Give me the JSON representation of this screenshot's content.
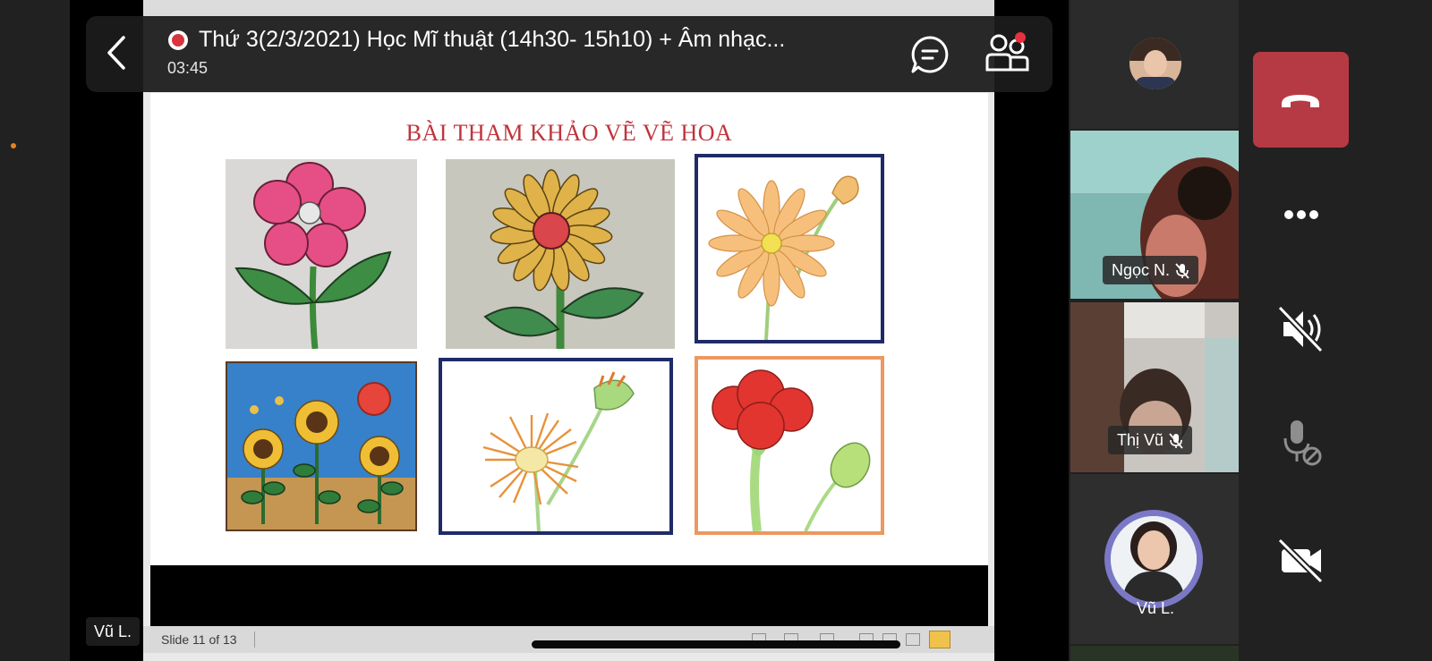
{
  "meeting": {
    "title": "Thứ 3(2/3/2021) Học Mĩ thuật (14h30- 15h10) + Âm nhạc...",
    "timer": "03:45",
    "recording": true,
    "has_notification": true
  },
  "slide": {
    "title": "BÀI THAM KHẢO VẼ VẼ HOA",
    "images": [
      "pink-flower-drawing",
      "yellow-daisy-drawing",
      "orange-flower-sketch",
      "sunflowers-painting",
      "orange-gerbera-sketch",
      "red-carnation-drawing"
    ]
  },
  "ppt_status": {
    "slide_counter": "Slide 11 of 13"
  },
  "presenter_label": "Vũ L.",
  "participants": [
    {
      "name": "",
      "muted": false,
      "kind": "avatar"
    },
    {
      "name": "Ngọc N.",
      "muted": true,
      "kind": "video"
    },
    {
      "name": "Thị Vũ",
      "muted": true,
      "kind": "video"
    },
    {
      "name": "Vũ L.",
      "muted": false,
      "kind": "avatar-ring"
    }
  ],
  "controls": {
    "leave": "phone-hangup-icon",
    "more": "more-options-icon",
    "speaker": "speaker-muted-icon",
    "mic": "mic-disabled-icon",
    "camera": "camera-off-icon"
  },
  "colors": {
    "leave_button": "#b63a43",
    "recording": "#d8343e",
    "slide_title": "#c0343c",
    "avatar_ring": "#7b78c7"
  }
}
